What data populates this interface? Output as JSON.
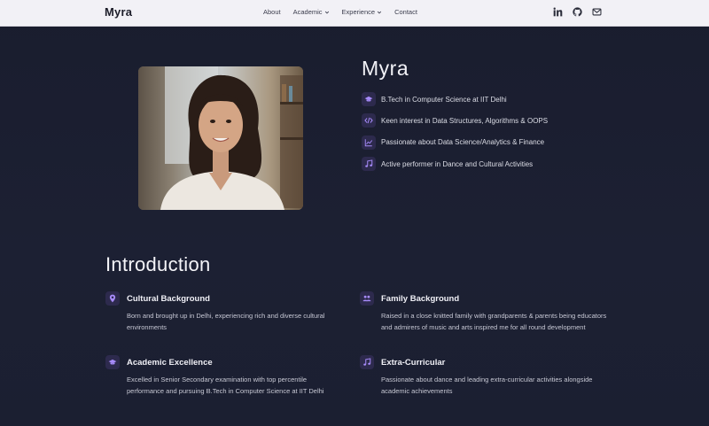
{
  "navbar": {
    "brand": "Myra",
    "links": [
      "About",
      "Academic",
      "Experience",
      "Contact"
    ],
    "icons": [
      "linkedin-icon",
      "github-icon",
      "mail-icon"
    ]
  },
  "hero": {
    "name": "Myra",
    "items": [
      {
        "icon": "graduation-cap-icon",
        "text": "B.Tech in Computer Science at IIT Delhi"
      },
      {
        "icon": "code-icon",
        "text": "Keen interest in Data Structures, Algorithms & OOPS"
      },
      {
        "icon": "chart-line-icon",
        "text": "Passionate about Data Science/Analytics & Finance"
      },
      {
        "icon": "music-note-icon",
        "text": "Active performer in Dance and Cultural Activities"
      }
    ]
  },
  "intro": {
    "title": "Introduction",
    "cards": [
      {
        "icon": "map-pin-icon",
        "title": "Cultural Background",
        "body": "Born and brought up in Delhi, experiencing rich and diverse cultural environments"
      },
      {
        "icon": "people-icon",
        "title": "Family Background",
        "body": "Raised in a close knitted family with grandparents & parents being educators and admirers of music and arts inspired me for all round development"
      },
      {
        "icon": "graduation-cap-icon",
        "title": "Academic Excellence",
        "body": "Excelled in Senior Secondary examination with top percentile performance and pursuing B.Tech in Computer Science at IIT Delhi"
      },
      {
        "icon": "music-note-icon",
        "title": "Extra-Curricular",
        "body": "Passionate about dance and leading extra-curricular activities alongside academic achievements"
      }
    ]
  },
  "colors": {
    "accent": "#a78bfa",
    "badge_bg": "#2d2a4d",
    "nav_bg": "#f2f1f6",
    "page_bg": "#1a1d2e"
  }
}
